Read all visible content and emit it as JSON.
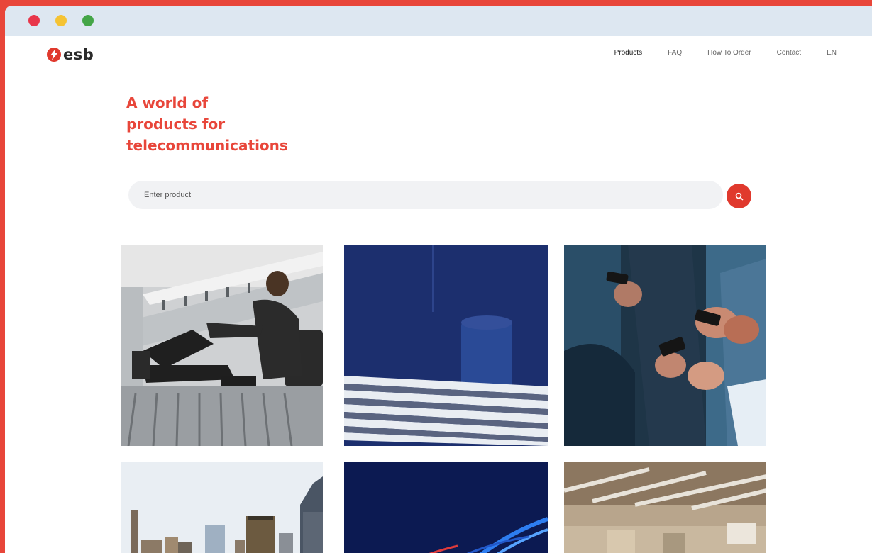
{
  "browser": {
    "controls": [
      "close",
      "minimize",
      "maximize"
    ]
  },
  "brand": {
    "logo_text": "esb",
    "accent_color": "#e8463a"
  },
  "nav": {
    "items": [
      {
        "label": "Products",
        "active": true
      },
      {
        "label": "FAQ",
        "active": false
      },
      {
        "label": "How To Order",
        "active": false
      },
      {
        "label": "Contact",
        "active": false
      },
      {
        "label": "EN",
        "active": false
      }
    ]
  },
  "hero": {
    "title_lines": [
      "A world of",
      "products for",
      "telecommunications"
    ]
  },
  "search": {
    "placeholder": "Enter product"
  },
  "gallery": {
    "tiles": [
      {
        "subject": "person-sitting-with-phone"
      },
      {
        "subject": "blue-architecture"
      },
      {
        "subject": "people-using-phones"
      },
      {
        "subject": "city-skyline"
      },
      {
        "subject": "light-trails"
      },
      {
        "subject": "industrial-ceiling"
      }
    ]
  }
}
